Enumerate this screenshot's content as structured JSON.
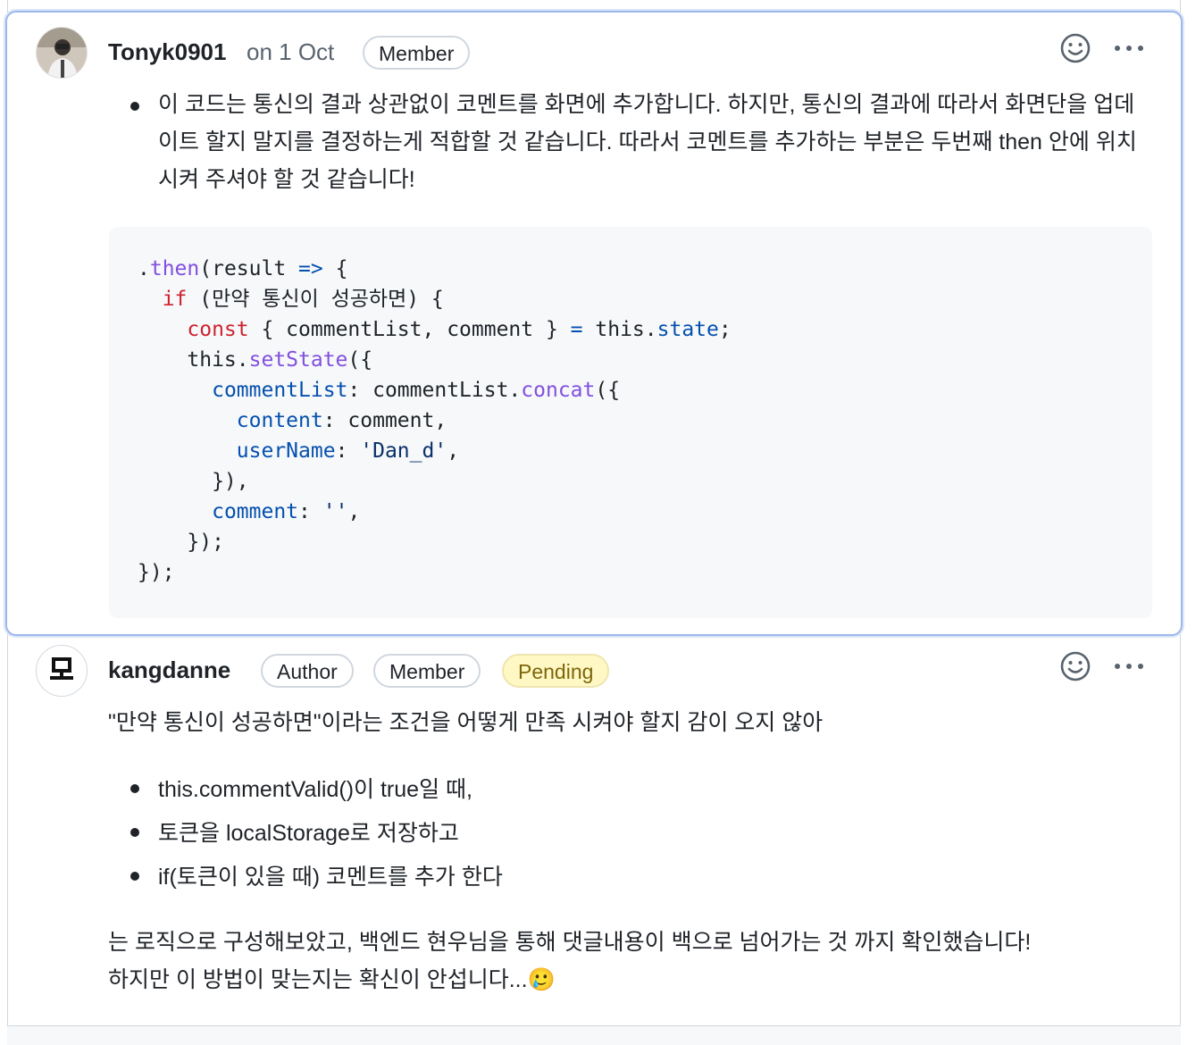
{
  "comment1": {
    "author": "Tonyk0901",
    "timestamp": "on 1 Oct",
    "badges": [
      "Member"
    ],
    "bullet": "이 코드는 통신의 결과 상관없이 코멘트를 화면에 추가합니다. 하지만, 통신의 결과에 따라서 화면단을 업데이트 할지 말지를 결정하는게 적합할 것 같습니다. 따라서 코멘트를 추가하는 부분은 두번째 then 안에 위치시켜 주셔야 할 것 같습니다!",
    "code": {
      "l1": {
        "a": ".",
        "b": "then",
        "c": "(result ",
        "d": "=>",
        "e": " {"
      },
      "l2": {
        "a": "  ",
        "b": "if",
        "c": " (만약 통신이 성공하면) {"
      },
      "l3": {
        "a": "    ",
        "b": "const",
        "c": " { commentList, comment } ",
        "d": "=",
        "e": " this.",
        "f": "state",
        "g": ";"
      },
      "l4": {
        "a": "    this.",
        "b": "setState",
        "c": "({"
      },
      "l5": {
        "a": "      ",
        "b": "commentList",
        "c": ": commentList.",
        "d": "concat",
        "e": "({"
      },
      "l6": {
        "a": "        ",
        "b": "content",
        "c": ": comment,"
      },
      "l7": {
        "a": "        ",
        "b": "userName",
        "c": ": ",
        "d": "'Dan_d'",
        "e": ","
      },
      "l8": {
        "a": "      }),"
      },
      "l9": {
        "a": "      ",
        "b": "comment",
        "c": ": ",
        "d": "''",
        "e": ","
      },
      "l10": {
        "a": "    });"
      },
      "l11": {
        "a": "});"
      }
    }
  },
  "comment2": {
    "author": "kangdanne",
    "badges": [
      "Author",
      "Member",
      "Pending"
    ],
    "intro": "\"만약 통신이 성공하면\"이라는 조건을 어떻게 만족 시켜야 할지 감이 오지 않아",
    "bullets": [
      "this.commentValid()이 true일 때,",
      "토큰을 localStorage로 저장하고",
      "if(토큰이 있을 때) 코멘트를 추가 한다"
    ],
    "outro_line1": "는 로직으로 구성해보았고, 백엔드 현우님을 통해 댓글내용이 백으로 넘어가는 것 까지 확인했습니다!",
    "outro_line2": "하지만 이 방법이 맞는지는 확신이 안섭니다...",
    "emoji": "🥲"
  },
  "icons": {
    "reaction": "smiley-icon",
    "more": "kebab-horizontal-icon"
  },
  "colors": {
    "highlight_border": "#9cb8ea",
    "pending_bg": "#fff8c5",
    "keyword": "#cf222e",
    "function": "#8250df",
    "property": "#0550ae"
  }
}
